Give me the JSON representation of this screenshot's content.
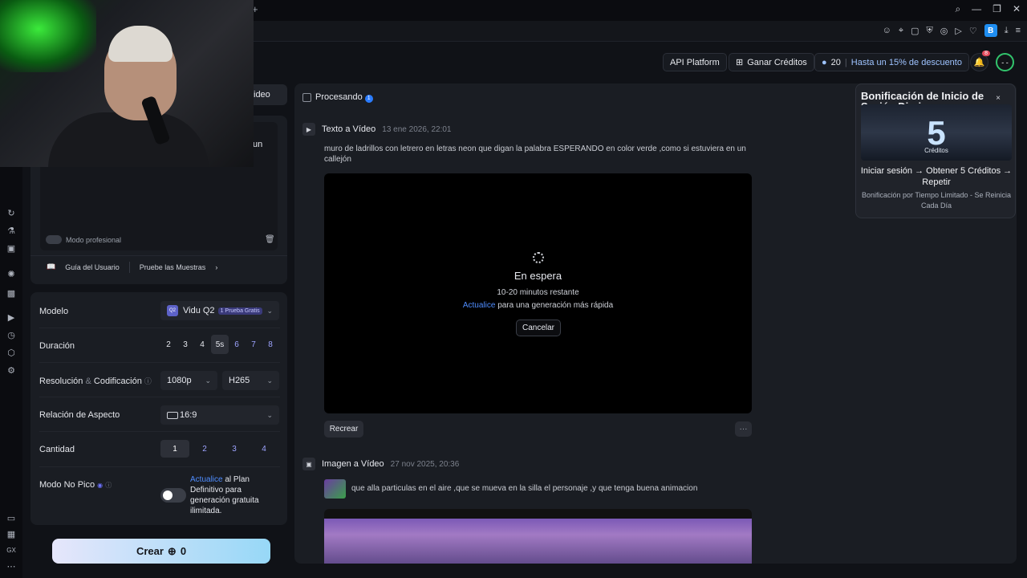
{
  "browser": {
    "new_tab": "+",
    "ext_b": "B"
  },
  "header": {
    "api_platform": "API Platform",
    "ganar": "Ganar Créditos",
    "credits": "20",
    "discount": "Hasta un 15% de descuento",
    "notif_count": "8",
    "avatar": "- -"
  },
  "left": {
    "video_tab": "ideo",
    "prompt_fragment": "un",
    "modo_pro": "Modo profesional",
    "guide": "Guía del Usuario",
    "samples": "Pruebe las Muestras",
    "modelo_label": "Modelo",
    "model_value": "Vidu Q2",
    "model_icon": "Q2",
    "model_tag": "1 Prueba Gratis",
    "duracion_label": "Duración",
    "durations": [
      "2",
      "3",
      "4",
      "5s",
      "6",
      "7",
      "8"
    ],
    "resol_label": "Resolución",
    "resol_amp": "&",
    "codif_label": "Codificación",
    "resolution": "1080p",
    "codec": "H265",
    "aspect_label": "Relación de Aspecto",
    "aspect": "16:9",
    "cantidad_label": "Cantidad",
    "quantities": [
      "1",
      "2",
      "3",
      "4"
    ],
    "nopico_label": "Modo No Pico",
    "upgrade_link": "Actualice",
    "upgrade_text": "al Plan Definitivo para generación gratuita ilimitada.",
    "crear": "Crear",
    "crear_cost": "0"
  },
  "main": {
    "processing": "Procesando",
    "processing_count": "1",
    "item1_type": "Texto a Vídeo",
    "item1_date": "13 ene 2026, 22:01",
    "item1_prompt": "muro de ladrillos con letrero en letras neon que digan la palabra ESPERANDO en color verde ,como si estuviera en un callejón",
    "wait_title": "En espera",
    "wait_time": "10-20 minutos restante",
    "wait_link": "Actualice",
    "wait_text": "para una generación más rápida",
    "cancel": "Cancelar",
    "recrear": "Recrear",
    "more": "···",
    "item2_type": "Imagen a Vídeo",
    "item2_date": "27 nov 2025, 20:36",
    "item2_prompt": "que alla particulas en el aire ,que se mueva en la silla el personaje ,y que tenga buena animacion"
  },
  "popup": {
    "title": "Bonificación de Inicio de Sesión Diario",
    "number": "5",
    "creditos": "Créditos",
    "line1": "Iniciar sesión → Obtener 5 Créditos → Repetir",
    "line2": "Bonificación por Tiempo Limitado - Se Reinicia Cada Día",
    "close": "×"
  },
  "sidebar": {
    "bottom_label": "GX"
  }
}
